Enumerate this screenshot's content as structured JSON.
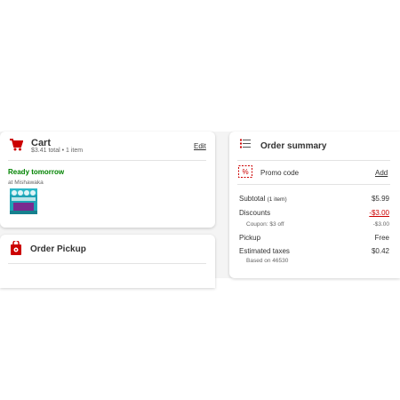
{
  "cart": {
    "title": "Cart",
    "subtitle": "$3.41 total • 1 item",
    "edit_label": "Edit",
    "ready_label": "Ready tomorrow",
    "store_label": "at Mishawaka"
  },
  "pickup": {
    "title": "Order Pickup"
  },
  "summary": {
    "title": "Order summary",
    "promo_label": "Promo code",
    "add_label": "Add",
    "subtotal_label": "Subtotal",
    "subtotal_count": "(1 item)",
    "subtotal_value": "$5.99",
    "discounts_label": "Discounts",
    "discounts_value": "-$3.00",
    "coupon_label": "Coupon: $3 off",
    "coupon_value": "-$3.00",
    "pickup_label": "Pickup",
    "pickup_value": "Free",
    "tax_label": "Estimated taxes",
    "tax_value": "$0.42",
    "tax_note": "Based on 46530"
  },
  "colors": {
    "brand_red": "#cc0000",
    "ready_green": "#008300"
  },
  "icons": [
    "cart-icon",
    "pickup-store-icon",
    "list-icon",
    "promo-icon"
  ]
}
